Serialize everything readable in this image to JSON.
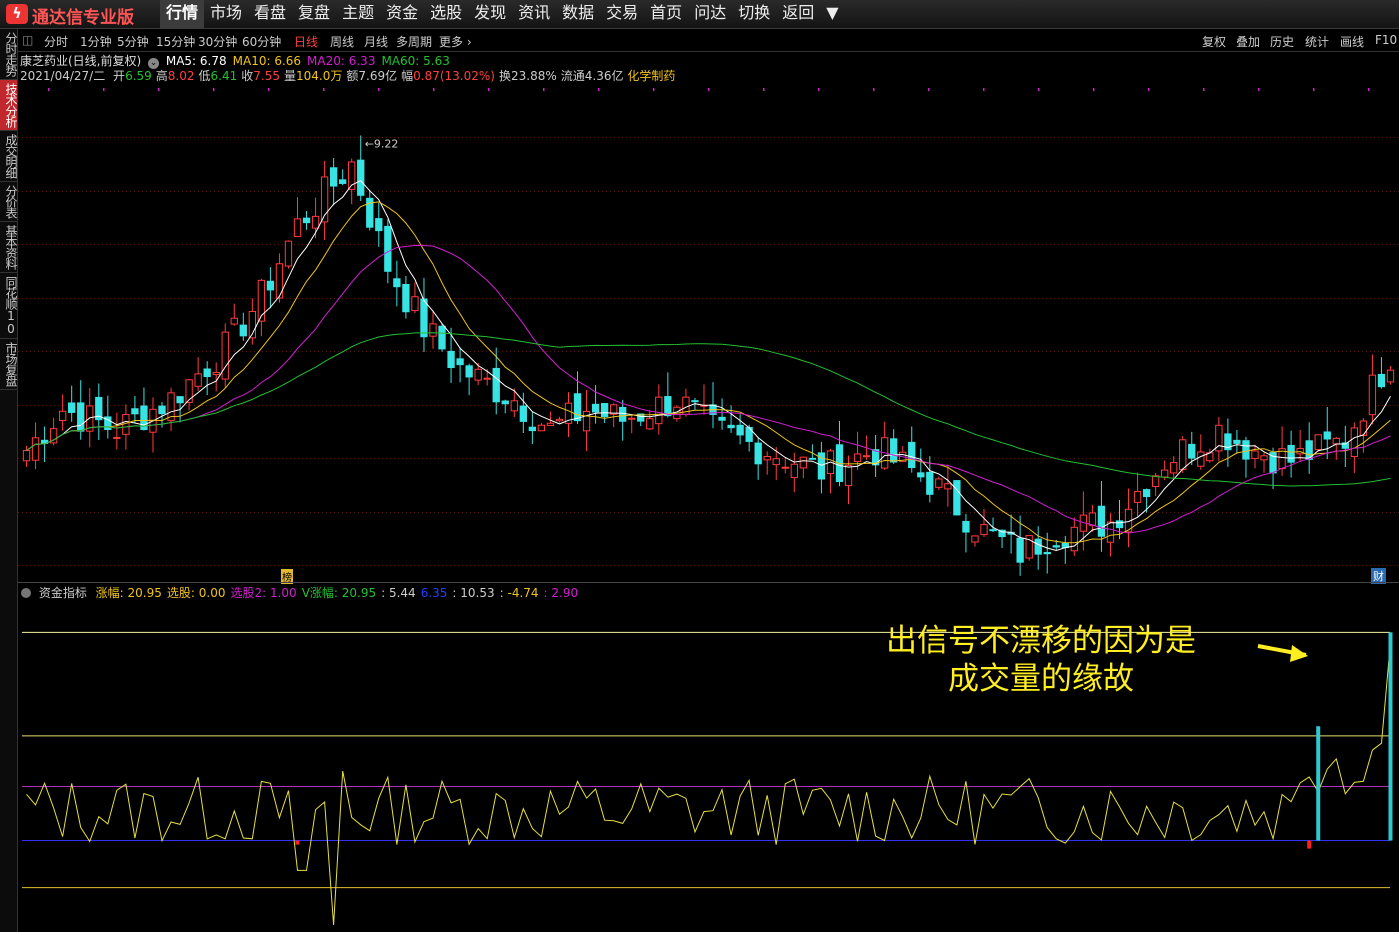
{
  "app": {
    "logo_glyph": "ϟ",
    "name": "通达信专业版"
  },
  "menu": [
    "行情",
    "市场",
    "看盘",
    "复盘",
    "主题",
    "资金",
    "选股",
    "发现",
    "资讯",
    "数据",
    "交易",
    "首页",
    "问达",
    "切换",
    "返回",
    "▼"
  ],
  "menu_active_index": 0,
  "left_tabs": [
    "分时走势",
    "技术分析",
    "成交明细",
    "分价表",
    "基本资料",
    "同花顺10",
    "市场复盘"
  ],
  "left_active_index": 1,
  "periods": [
    "分时",
    "1分钟",
    "5分钟",
    "15分钟",
    "30分钟",
    "60分钟",
    "日线",
    "周线",
    "月线",
    "多周期",
    "更多 ›"
  ],
  "period_active": "日线",
  "right_tools": [
    "复权",
    "叠加",
    "历史",
    "统计",
    "画线",
    "F10"
  ],
  "stock": {
    "title": "康芝药业(日线,前复权)",
    "ma": [
      {
        "label": "MA5: 6.78",
        "color": "#ffffff"
      },
      {
        "label": "MA10: 6.66",
        "color": "#f0c419"
      },
      {
        "label": "MA20: 6.33",
        "color": "#d020d0"
      },
      {
        "label": "MA60: 5.63",
        "color": "#22c033"
      }
    ],
    "date": "2021/04/27/二",
    "quote": [
      {
        "label": "开",
        "value": "6.59",
        "color": "#22c033"
      },
      {
        "label": "高",
        "value": "8.02",
        "color": "#ff4040"
      },
      {
        "label": "低",
        "value": "6.41",
        "color": "#22c033"
      },
      {
        "label": "收",
        "value": "7.55",
        "color": "#ff4040"
      },
      {
        "label": "量",
        "value": "104.0万",
        "color": "#f0c419"
      },
      {
        "label": "额",
        "value": "7.69亿",
        "color": "#cccccc"
      },
      {
        "label": "幅",
        "value": "0.87(13.02%)",
        "color": "#ff4040"
      },
      {
        "label": "换",
        "value": "23.88%",
        "color": "#cccccc"
      },
      {
        "label": "流通",
        "value": "4.36亿",
        "color": "#cccccc"
      }
    ],
    "industry": "化学制药",
    "high_mark": "9.22",
    "low_mark": "4.78"
  },
  "indicator": {
    "name": "资金指标",
    "items": [
      {
        "label": "涨幅:",
        "value": "20.95",
        "color": "#f0c419"
      },
      {
        "label": "选股:",
        "value": "0.00",
        "color": "#f0c419"
      },
      {
        "label": "选股2:",
        "value": "1.00",
        "color": "#d020d0"
      },
      {
        "label": "V涨幅:",
        "value": "20.95",
        "color": "#22c033"
      },
      {
        "label": ":",
        "value": "5.44",
        "color": "#cccccc"
      },
      {
        "label": "",
        "value": "6.35",
        "color": "#2040ff"
      },
      {
        "label": ":",
        "value": "10.53",
        "color": "#cccccc"
      },
      {
        "label": ":",
        "value": "-4.74",
        "color": "#f0c419"
      },
      {
        "label": ":",
        "value": "2.90",
        "color": "#d020d0"
      }
    ]
  },
  "annotation": {
    "line1": "出信号不漂移的因为是",
    "line2": "成交量的缘故"
  },
  "badges": {
    "bang": "榜",
    "fin": "财"
  },
  "colors": {
    "up": "#ff3b3b",
    "down": "#38e3e3",
    "ma5": "#ffffff",
    "ma10": "#f0c419",
    "ma20": "#d020d0",
    "ma60": "#22c033",
    "grid": "#5a1414",
    "accent": "#ffee22"
  },
  "chart_data": {
    "type": "candlestick",
    "price_range": [
      4.6,
      9.3
    ],
    "days": 152,
    "anchors_close": [
      [
        0,
        5.8
      ],
      [
        4,
        6.2
      ],
      [
        10,
        6.0
      ],
      [
        16,
        6.3
      ],
      [
        22,
        6.8
      ],
      [
        26,
        7.3
      ],
      [
        30,
        8.0
      ],
      [
        34,
        8.4
      ],
      [
        36,
        8.6
      ],
      [
        40,
        7.6
      ],
      [
        44,
        7.0
      ],
      [
        48,
        6.6
      ],
      [
        54,
        6.3
      ],
      [
        58,
        6.0
      ],
      [
        62,
        6.2
      ],
      [
        66,
        6.1
      ],
      [
        72,
        6.3
      ],
      [
        76,
        6.0
      ],
      [
        82,
        5.8
      ],
      [
        88,
        5.6
      ],
      [
        94,
        5.8
      ],
      [
        100,
        5.5
      ],
      [
        106,
        5.0
      ],
      [
        110,
        4.8
      ],
      [
        114,
        5.0
      ],
      [
        120,
        5.1
      ],
      [
        126,
        5.7
      ],
      [
        132,
        6.0
      ],
      [
        136,
        5.8
      ],
      [
        140,
        5.7
      ],
      [
        146,
        5.9
      ],
      [
        152,
        6.9
      ]
    ],
    "volume_indicator_levels": {
      "upper": 20.95,
      "mid": 10.53,
      "purple": 5.44,
      "base": 0.0,
      "low": -4.74
    }
  }
}
